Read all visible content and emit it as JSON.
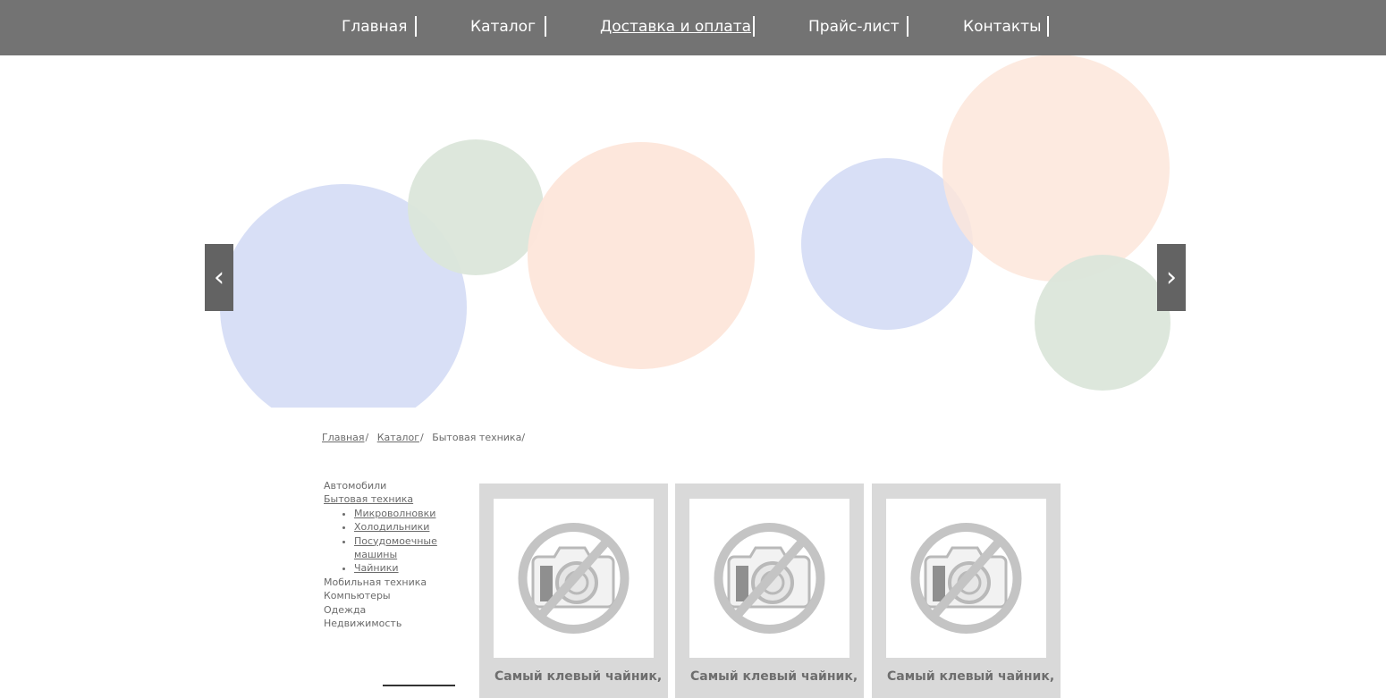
{
  "nav": {
    "items": [
      {
        "label": "Главная",
        "active": false
      },
      {
        "label": "Каталог",
        "active": false
      },
      {
        "label": "Доставка и оплата",
        "active": true
      },
      {
        "label": "Прайс-лист",
        "active": false
      },
      {
        "label": "Контакты",
        "active": false
      }
    ]
  },
  "slider": {
    "prev_icon": "‹",
    "next_icon": "›",
    "circle_colors": [
      "#d6ddf6",
      "#dbe6da",
      "#fde6da"
    ]
  },
  "breadcrumb": {
    "items": [
      {
        "label": "Главная",
        "link": true
      },
      {
        "label": "Каталог",
        "link": true
      },
      {
        "label": "Бытовая техника",
        "link": false
      }
    ],
    "separator": "/"
  },
  "sidebar": {
    "categories": [
      {
        "label": "Автомобили",
        "active": false
      },
      {
        "label": "Бытовая техника",
        "active": true,
        "children": [
          "Микроволновки",
          "Холодильники",
          "Посудомоечные машины",
          "Чайники"
        ]
      },
      {
        "label": "Мобильная техника",
        "active": false
      },
      {
        "label": "Компьютеры",
        "active": false
      },
      {
        "label": "Одежда",
        "active": false
      },
      {
        "label": "Недвижимость",
        "active": false
      }
    ]
  },
  "products": [
    {
      "title": "Самый клевый чайник,",
      "image_icon": "no-photo-icon"
    },
    {
      "title": "Самый клевый чайник,",
      "image_icon": "no-photo-icon"
    },
    {
      "title": "Самый клевый чайник,",
      "image_icon": "no-photo-icon"
    }
  ]
}
